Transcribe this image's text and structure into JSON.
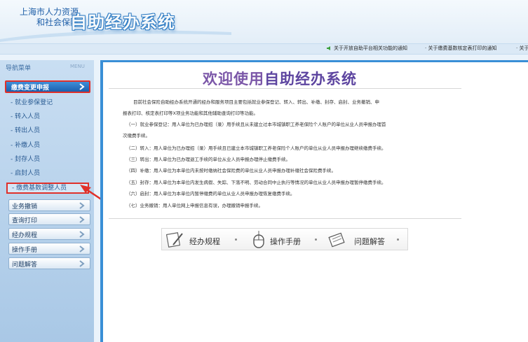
{
  "header": {
    "org_line1": "上海市人力资源",
    "org_line2": "和社会保障",
    "system_title": "自助经办系统"
  },
  "notices": [
    "关于开放自助平台相关功能的通知",
    "关于缴费基数核定表打印的通知",
    "关于"
  ],
  "sidebar": {
    "title": "导航菜单",
    "menu_tag": "MENU",
    "active_group": "缴费变更申报",
    "sub_items": [
      "就业参保登记",
      "转入人员",
      "转出人员",
      "补缴人员",
      "封存人员",
      "启封人员",
      "缴费基数调整人员"
    ],
    "groups": [
      "业务撤销",
      "查询打印",
      "经办规程",
      "操作手册",
      "问题解答"
    ]
  },
  "content": {
    "welcome_prefix": "欢迎使用",
    "welcome_suffix": "自助经办系统",
    "paragraphs": [
      "目前社会保险自助经办系统开通的经办和服务项目主要包括就业参保登记、转入、转出、补缴、封存、启封、业务撤销、申",
      "报表打印、核定表打印等X项业务功能和其他辅助查询打印等功能。",
      "（一）就业参保登记：用人单位为已办理招（录）用手续且从未建立过本市城镇职工养老保险个人账户的单位从业人员申报办理首",
      "次缴费手续。",
      "（二）转入：用人单位为已办理招（录）用手续且已建立本市城镇职工养老保险个人账户的单位从业人员申报办理继续缴费手续。",
      "（三）转出：用人单位为已办理退工手续的单位从业人员申报办理停止缴费手续。",
      "（四）补缴：用人单位为本单位内未按时缴纳社会保险费的单位从业人员申报办理补缴社会保险费手续。",
      "（五）封存：用人单位为本单位内发生病假、失踪、下落不明、劳动合同中止执行等情况的单位从业人员申报办理暂停缴费手续。",
      "（六）启封：用人单位为本单位内暂停缴费的单位从业人员申报办理恢复缴费手续。",
      "（七）业务撤销：用人单位网上申报信息有误，办理撤销申报手续。"
    ],
    "quick_links": [
      "经办规程",
      "操作手册",
      "问题解答"
    ]
  },
  "colors": {
    "accent_blue": "#3a8fd6",
    "highlight_red": "#e0302a",
    "welcome_purple": "#7b57a8"
  }
}
